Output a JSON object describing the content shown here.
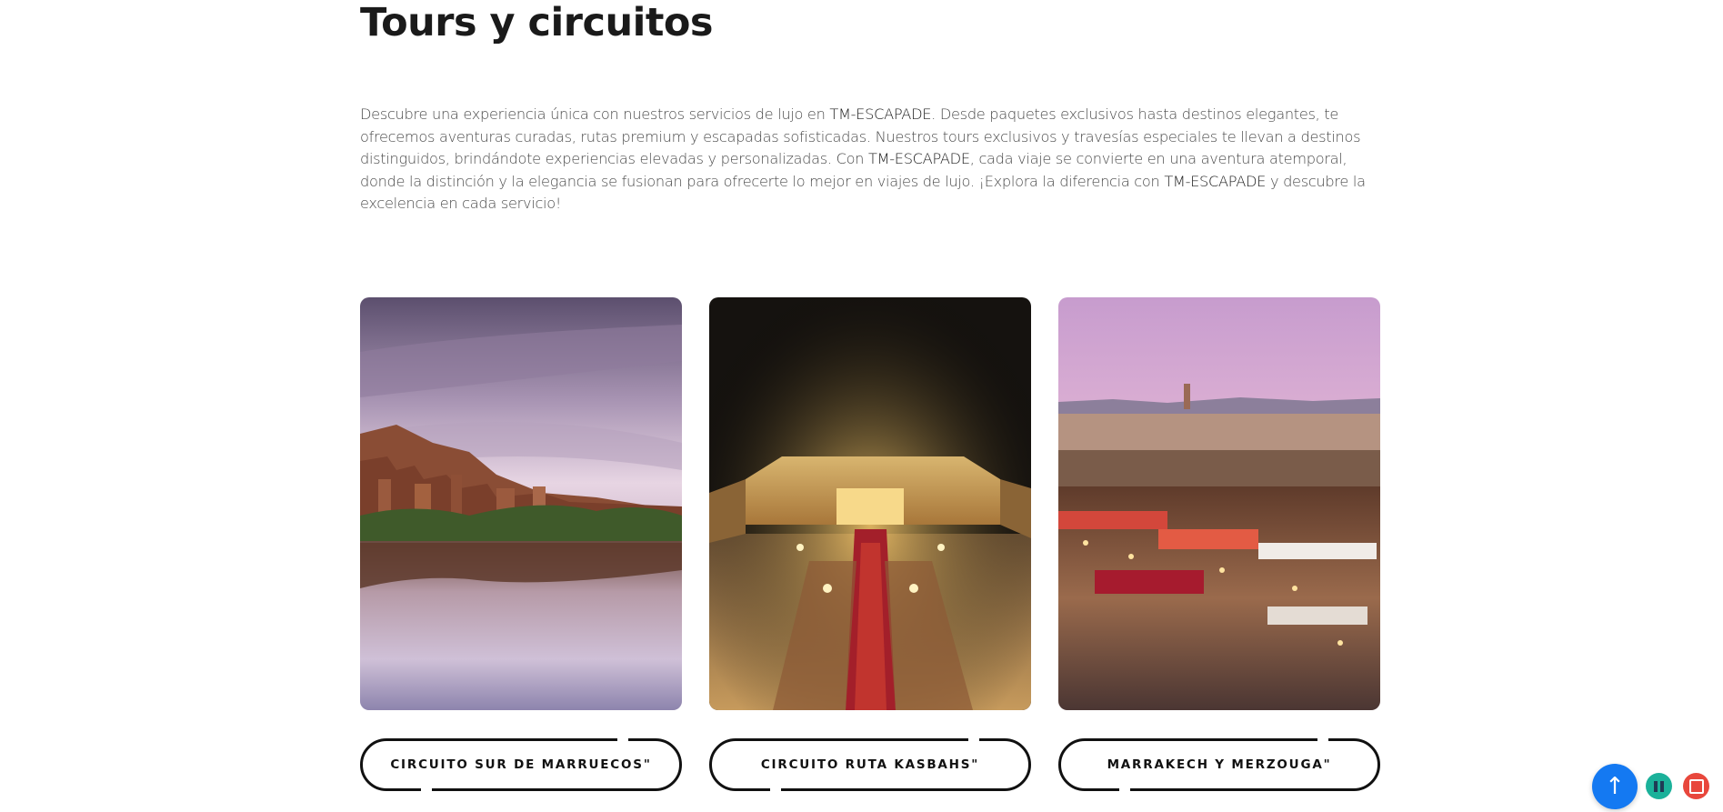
{
  "section": {
    "title": "Tours y circuitos",
    "intro": {
      "p1": "Descubre una experiencia única con nuestros servicios de lujo en ",
      "brand1": "TM-ESCAPADE",
      "p2": ". Desde paquetes exclusivos hasta destinos elegantes, te ofrecemos aventuras curadas, rutas premium y escapadas sofisticadas. Nuestros tours exclusivos y travesías especiales te llevan a destinos distinguidos, brindándote experiencias elevadas y personalizadas. Con ",
      "brand2": "TM-ESCAPADE",
      "p3": ", cada viaje se convierte en una aventura atemporal, donde la distinción y la elegancia se fusionan para ofrecerte lo mejor en viajes de lujo. ¡Explora la diferencia con ",
      "brand3": "TM-ESCAPADE",
      "p4": " y descubre la excelencia en cada servicio!"
    }
  },
  "tours": [
    {
      "button_label": "CIRCUITO SUR DE MARRUECOS\"",
      "image": "kasbah-river-reflection"
    },
    {
      "button_label": "CIRCUITO RUTA KASBAHS\"",
      "image": "desert-camp-night"
    },
    {
      "button_label": "MARRAKECH Y MERZOUGA\"",
      "image": "marrakech-square-market"
    }
  ],
  "floating": {
    "back_to_top_icon": "arrow-up-icon",
    "pause_icon": "pause-icon",
    "stop_icon": "stop-icon"
  },
  "colors": {
    "back_to_top": "#1479f2",
    "pause": "#1bb19a",
    "stop": "#e8473c"
  }
}
